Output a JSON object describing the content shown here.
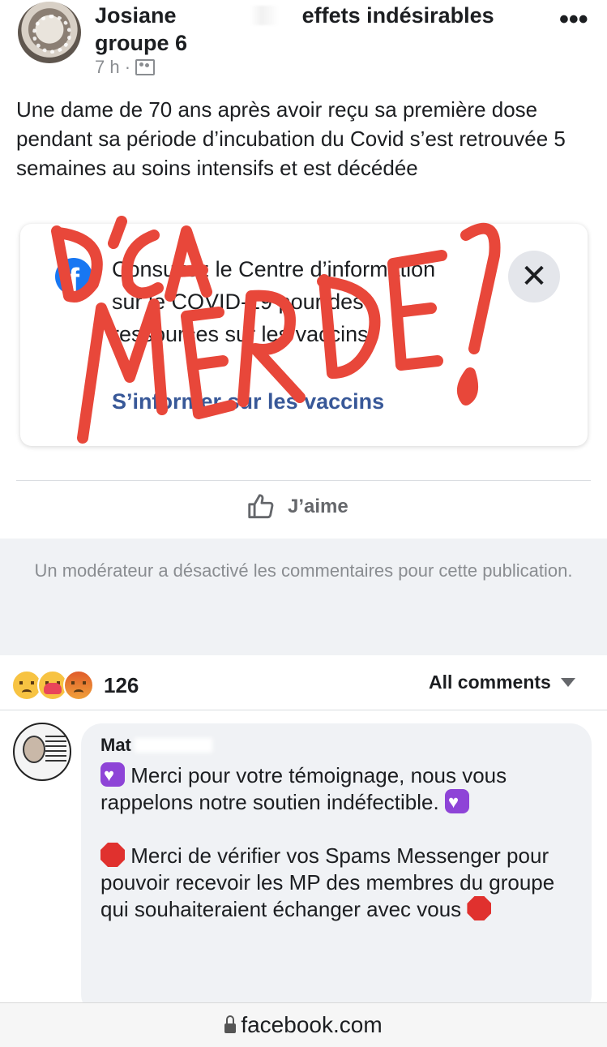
{
  "post": {
    "author_first": "Josiane",
    "author_rest": "effets indésirables groupe 6",
    "time": "7 h ·",
    "text": "Une dame de 70 ans après avoir reçu sa première dose pendant sa période d’incubation du Covid s’est retrouvée 5 semaines au soins intensifs et est décédée"
  },
  "info_card": {
    "text": "Consultez le Centre d’information sur le COVID-19 pour des ressources sur les vaccins.",
    "link": "S’informer sur les vaccins",
    "close_icon": "close-icon"
  },
  "overlay_graffiti": "D’CA MERDE!",
  "actions": {
    "like_label": "J’aime"
  },
  "comments_disabled": "Un modérateur a désactivé les commentaires pour cette publication.",
  "reactions": {
    "icons": [
      "sad-icon",
      "care-icon",
      "angry-icon"
    ],
    "count": "126"
  },
  "comments_filter": "All comments",
  "comment": {
    "author": "Mat",
    "para1": "Merci pour votre témoignage, nous vous rappelons notre soutien indéfectible.",
    "para2": "Merci de vérifier vos Spams Messenger pour pouvoir recevoir les MP des membres du groupe qui souhaiteraient échanger avec vous"
  },
  "browser": {
    "url": "facebook.com"
  },
  "colors": {
    "link": "#385898",
    "fb_blue": "#1877f2",
    "graffiti": "#e8473a",
    "muted": "#8a8d91"
  }
}
